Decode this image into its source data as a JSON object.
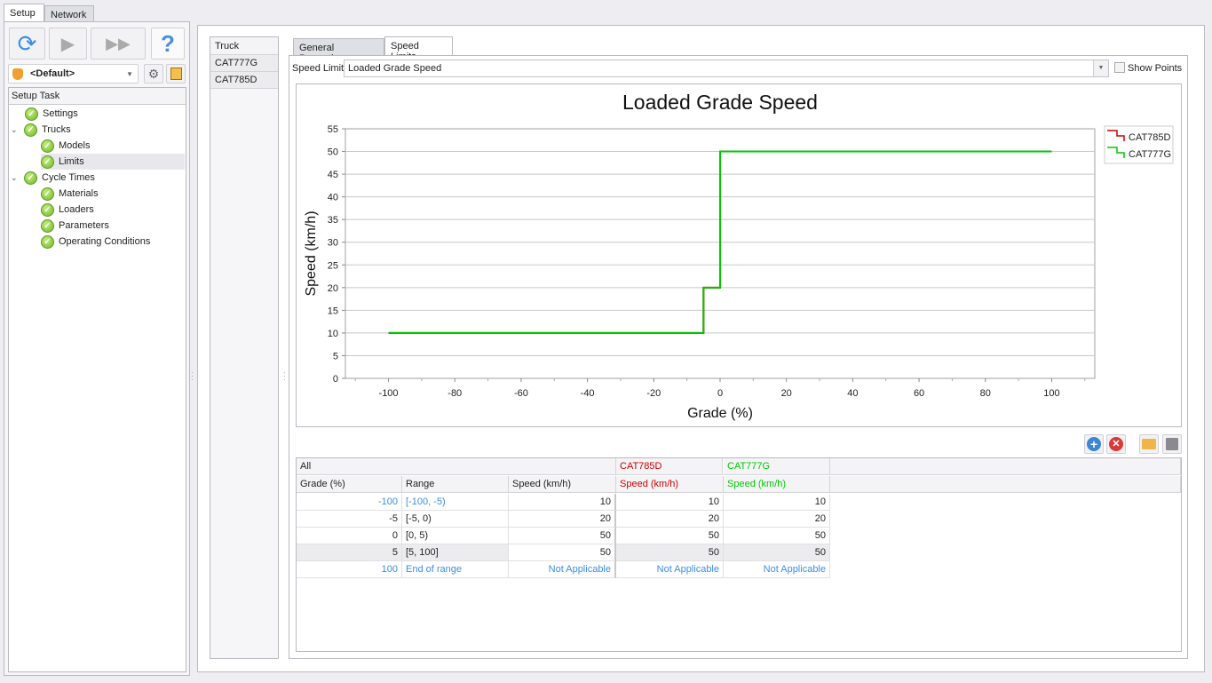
{
  "top_tabs": [
    "Setup",
    "Network"
  ],
  "left": {
    "profile": "<Default>",
    "tree_header": "Setup Task",
    "tree": [
      {
        "label": "Settings",
        "level": 1,
        "expander": false
      },
      {
        "label": "Trucks",
        "level": 0,
        "expander": true
      },
      {
        "label": "Models",
        "level": 2,
        "expander": false
      },
      {
        "label": "Limits",
        "level": 2,
        "expander": false,
        "selected": true
      },
      {
        "label": "Cycle Times",
        "level": 0,
        "expander": true
      },
      {
        "label": "Materials",
        "level": 2,
        "expander": false
      },
      {
        "label": "Loaders",
        "level": 2,
        "expander": false
      },
      {
        "label": "Parameters",
        "level": 2,
        "expander": false
      },
      {
        "label": "Operating Conditions",
        "level": 2,
        "expander": false
      }
    ]
  },
  "trucks": {
    "header": "Truck",
    "items": [
      "CAT777G",
      "CAT785D"
    ]
  },
  "content_tabs": [
    "General Properties",
    "Speed Limits"
  ],
  "speed_limit": {
    "label": "Speed Limit",
    "value": "Loaded Grade Speed",
    "show_points_label": "Show Points",
    "show_points": false
  },
  "chart_data": {
    "type": "line",
    "title": "Loaded Grade Speed",
    "xlabel": "Grade (%)",
    "ylabel": "Speed (km/h)",
    "xlim": [
      -113,
      113
    ],
    "ylim": [
      0,
      55
    ],
    "xticks": [
      -100,
      -80,
      -60,
      -40,
      -20,
      0,
      20,
      40,
      60,
      80,
      100
    ],
    "yticks": [
      0,
      5,
      10,
      15,
      20,
      25,
      30,
      35,
      40,
      45,
      50,
      55
    ],
    "grid": "horizontal",
    "legend": "top-right",
    "step": true,
    "series": [
      {
        "name": "CAT785D",
        "color": "#cc0000",
        "x": [
          -100,
          -5,
          0,
          100
        ],
        "y": [
          10,
          20,
          50,
          50
        ]
      },
      {
        "name": "CAT777G",
        "color": "#00c800",
        "x": [
          -100,
          -5,
          0,
          100
        ],
        "y": [
          10,
          20,
          50,
          50
        ]
      }
    ]
  },
  "grid": {
    "group_all": "All",
    "groups": [
      {
        "name": "CAT785D",
        "color": "#cc0000"
      },
      {
        "name": "CAT777G",
        "color": "#00c800"
      }
    ],
    "columns": [
      "Grade (%)",
      "Range",
      "Speed (km/h)",
      "Speed (km/h)",
      "Speed (km/h)"
    ],
    "rows": [
      [
        "-100",
        "[-100, -5)",
        "10",
        "10",
        "10"
      ],
      [
        "-5",
        "[-5, 0)",
        "20",
        "20",
        "20"
      ],
      [
        "0",
        "[0, 5)",
        "50",
        "50",
        "50"
      ],
      [
        "5",
        "[5, 100]",
        "50",
        "50",
        "50"
      ],
      [
        "100",
        "End of range",
        "Not Applicable",
        "Not Applicable",
        "Not Applicable"
      ]
    ]
  }
}
